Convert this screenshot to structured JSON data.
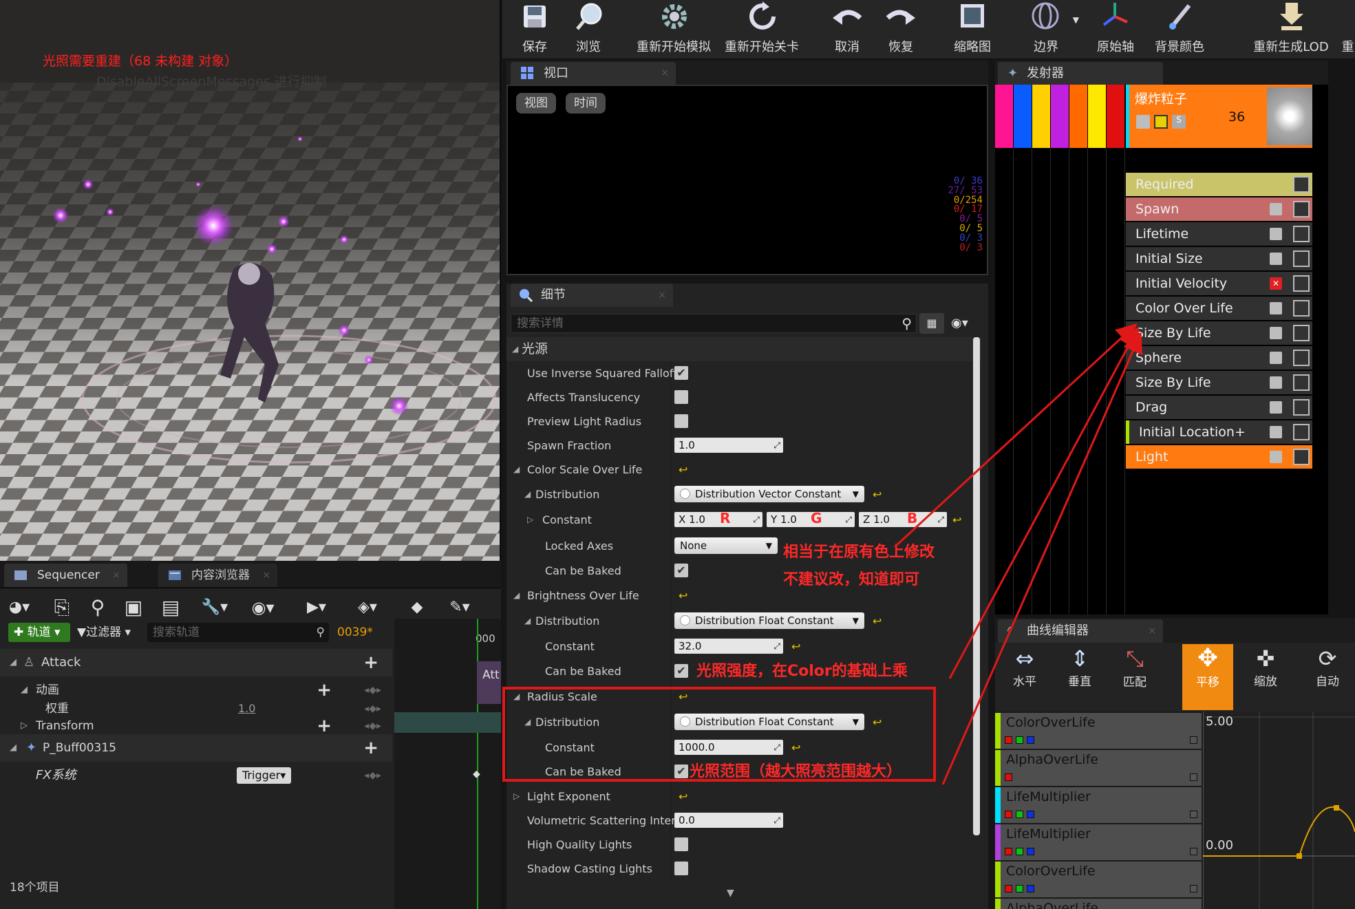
{
  "viewport": {
    "warning": "光照需要重建（68 未构建 对象）",
    "sub_message": "DisableAllScreenMessages 进行抑制"
  },
  "toolbar": {
    "items": [
      {
        "label": "保存",
        "icon": "save-icon"
      },
      {
        "label": "浏览",
        "icon": "browse-icon"
      },
      {
        "label": "重新开始模拟",
        "icon": "restart-sim-icon"
      },
      {
        "label": "重新开始关卡",
        "icon": "restart-level-icon"
      },
      {
        "label": "取消",
        "icon": "undo-icon"
      },
      {
        "label": "恢复",
        "icon": "redo-icon"
      },
      {
        "label": "缩略图",
        "icon": "thumbnail-icon"
      },
      {
        "label": "边界",
        "icon": "bounds-icon"
      },
      {
        "label": "原始轴",
        "icon": "axis-icon"
      },
      {
        "label": "背景颜色",
        "icon": "bg-color-icon"
      },
      {
        "label": "重新生成LOD",
        "icon": "regen-lod-icon"
      },
      {
        "label": "重",
        "icon": "more-icon"
      }
    ]
  },
  "viewport_panel": {
    "tab": "视口",
    "buttons": [
      "视图",
      "时间"
    ],
    "stats": [
      {
        "text": "0/ 36",
        "color": "#3a3acb"
      },
      {
        "text": "27/ 53",
        "color": "#6a1ea0"
      },
      {
        "text": "0/254",
        "color": "#e0a000"
      },
      {
        "text": "0/ 17",
        "color": "#d02020"
      },
      {
        "text": "0/  5",
        "color": "#8a1c9e"
      },
      {
        "text": "0/  5",
        "color": "#d8b000"
      },
      {
        "text": "0/  3",
        "color": "#2a4ad0"
      },
      {
        "text": "0/  3",
        "color": "#c02020"
      }
    ]
  },
  "details": {
    "tab": "细节",
    "search_placeholder": "搜索详情",
    "section": "光源",
    "rows": {
      "use_inverse": "Use Inverse Squared Falloff",
      "affects_trans": "Affects Translucency",
      "preview_radius": "Preview Light Radius",
      "spawn_fraction": "Spawn Fraction",
      "spawn_fraction_val": "1.0",
      "color_scale": "Color Scale Over Life",
      "distribution": "Distribution",
      "dist_vector": "Distribution Vector Constant",
      "constant": "Constant",
      "x_label": "X",
      "x_val": "1.0",
      "y_label": "Y",
      "y_val": "1.0",
      "z_label": "Z",
      "z_val": "1.0",
      "r_mark": "R",
      "g_mark": "G",
      "b_mark": "B",
      "locked_axes": "Locked Axes",
      "locked_val": "None",
      "can_be_baked": "Can be Baked",
      "brightness": "Brightness Over Life",
      "dist_float": "Distribution Float Constant",
      "brightness_val": "32.0",
      "radius_scale": "Radius Scale",
      "radius_val": "1000.0",
      "light_exponent": "Light Exponent",
      "vol_scatter": "Volumetric Scattering Intensit",
      "vol_val": "0.0",
      "hq_lights": "High Quality Lights",
      "shadow_lights": "Shadow Casting Lights"
    },
    "annotations": {
      "color_note_1": "相当于在原有色上修改",
      "color_note_2": "不建议改，知道即可",
      "brightness_note": "光照强度，在Color的基础上乘",
      "radius_note": "光照范围（越大照亮范围越大）"
    }
  },
  "emitters": {
    "tab": "发射器",
    "emitter_name": "爆炸粒子",
    "emitter_count": "36",
    "stripe_colors": [
      "#ff1493",
      "#0a5cff",
      "#ffd000",
      "#c020e0",
      "#ff6a00",
      "#ffe800",
      "#e01010"
    ],
    "modules": [
      {
        "label": "Required",
        "bg": "#c9c46a",
        "check": false
      },
      {
        "label": "Spawn",
        "bg": "#c56a6a",
        "check": true
      },
      {
        "label": "Lifetime",
        "bg": "#313131",
        "check": true
      },
      {
        "label": "Initial Size",
        "bg": "#313131",
        "check": true
      },
      {
        "label": "Initial Velocity",
        "bg": "#313131",
        "check": "disabled"
      },
      {
        "label": "Color Over Life",
        "bg": "#313131",
        "check": true
      },
      {
        "label": "Size By Life",
        "bg": "#313131",
        "check": true
      },
      {
        "label": "Sphere",
        "bg": "#313131",
        "check": true
      },
      {
        "label": "Size By Life",
        "bg": "#313131",
        "check": true
      },
      {
        "label": "Drag",
        "bg": "#313131",
        "check": true
      },
      {
        "label": "Initial Location+",
        "bg": "#313131",
        "check": true
      },
      {
        "label": "Light",
        "bg": "#ff7a10",
        "check": true
      }
    ]
  },
  "curve_editor": {
    "tab": "曲线编辑器",
    "tools": [
      "水平",
      "垂直",
      "匹配",
      "平移",
      "缩放",
      "自动"
    ],
    "tracks": [
      {
        "label": "ColorOverLife",
        "bar": "#a8e000"
      },
      {
        "label": "AlphaOverLife",
        "bar": "#a8e000"
      },
      {
        "label": "LifeMultiplier",
        "bar": "#00e0ff"
      },
      {
        "label": "LifeMultiplier",
        "bar": "#b040e0"
      },
      {
        "label": "ColorOverLife",
        "bar": "#a8e000"
      },
      {
        "label": "AlphaOverLife",
        "bar": "#a8e000"
      }
    ],
    "y_top": "5.00",
    "y_zero": "0.00"
  },
  "sequencer": {
    "tab": "Sequencer",
    "tab2": "内容浏览器",
    "add_track": "轨道",
    "filter": "过滤器",
    "search_placeholder": "搜索轨道",
    "frame": "0039*",
    "time_label": "000",
    "attack": "Attack",
    "anim": "动画",
    "weight": "权重",
    "weight_val": "1.0",
    "transform": "Transform",
    "buff": "P_Buff00315",
    "fx": "FX系统",
    "trigger": "Trigger",
    "clip_label": "Att",
    "item_count": "18个项目"
  }
}
